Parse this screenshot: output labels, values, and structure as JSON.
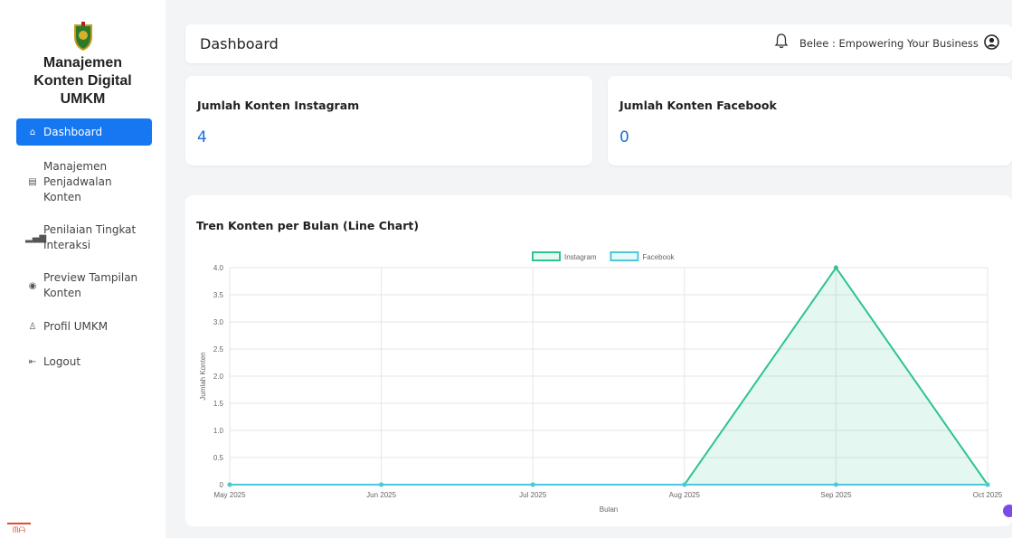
{
  "sidebar": {
    "brand": [
      "Manajemen",
      "Konten Digital",
      "UMKM"
    ],
    "items": [
      {
        "label": [
          "Dashboard"
        ],
        "icon": "home-icon",
        "active": true
      },
      {
        "label": [
          "Manajemen",
          "Penjadwalan",
          "Konten"
        ],
        "icon": "document-icon",
        "active": false
      },
      {
        "label": [
          "Penilaian Tingkat",
          "Interaksi"
        ],
        "icon": "signal-bars-icon",
        "active": false
      },
      {
        "label": [
          "Preview Tampilan",
          "Konten"
        ],
        "icon": "eye-icon",
        "active": false
      },
      {
        "label": [
          "Profil UMKM"
        ],
        "icon": "user-icon",
        "active": false
      },
      {
        "label": [
          "Logout"
        ],
        "icon": "logout-icon",
        "active": false
      }
    ]
  },
  "header": {
    "title": "Dashboard",
    "business": "Belee : Empowering Your Business"
  },
  "stats": [
    {
      "label": "Jumlah Konten Instagram",
      "value": "4"
    },
    {
      "label": "Jumlah Konten Facebook",
      "value": "0"
    }
  ],
  "chart": {
    "title": "Tren Konten per Bulan (Line Chart)"
  },
  "colors": {
    "primary": "#1677f2",
    "instagram": "#2ec48d",
    "facebook": "#4cc9d9"
  },
  "chart_data": {
    "type": "line",
    "x": [
      "May 2025",
      "Jun 2025",
      "Jul 2025",
      "Aug 2025",
      "Sep 2025",
      "Oct 2025"
    ],
    "series": [
      {
        "name": "Instagram",
        "values": [
          0,
          0,
          0,
          0,
          4,
          0
        ],
        "color": "#2ec48d",
        "fill": true
      },
      {
        "name": "Facebook",
        "values": [
          0,
          0,
          0,
          0,
          0,
          0
        ],
        "color": "#4cc9d9",
        "fill": false
      }
    ],
    "yticks": [
      "0",
      "0.5",
      "1.0",
      "1.5",
      "2.0",
      "2.5",
      "3.0",
      "3.5",
      "4.0"
    ],
    "ylim": [
      0,
      4
    ],
    "xlabel": "Bulan",
    "ylabel": "Jumlah Konten",
    "legend": "top-center",
    "grid": true
  }
}
